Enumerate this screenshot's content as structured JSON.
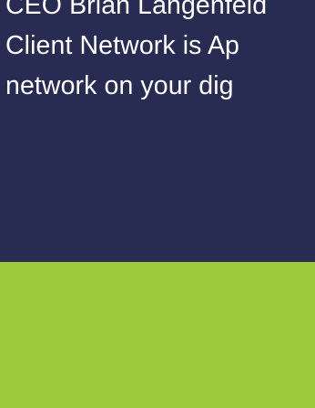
{
  "hero": {
    "lines": [
      "CEO Brian Langenfeld",
      "Client Network is Ap",
      "network on your dig"
    ],
    "background_color": "#282b52",
    "text_color": "#ffffff"
  },
  "band": {
    "color": "#9dca3c"
  }
}
